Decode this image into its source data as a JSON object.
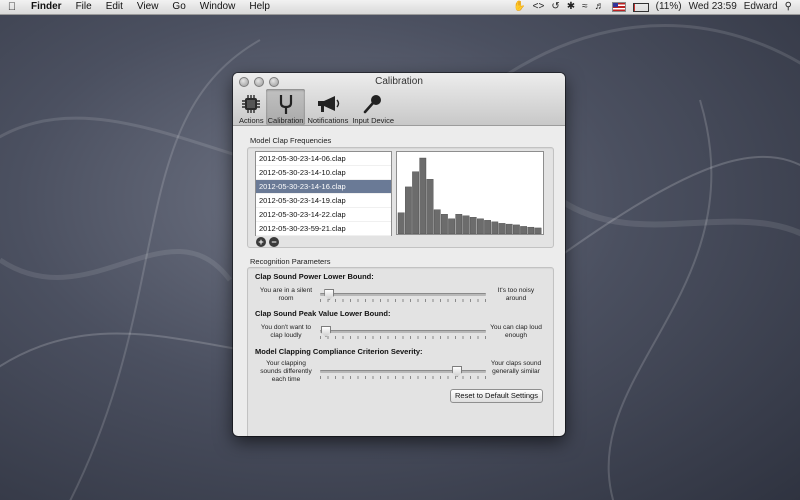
{
  "menubar": {
    "app_name": "Finder",
    "items": [
      "File",
      "Edit",
      "View",
      "Go",
      "Window",
      "Help"
    ],
    "battery_text": "(11%)",
    "battery_level": 0.11,
    "clock": "Wed 23:59",
    "user": "Edward",
    "tray_icons": [
      "clapper-icon",
      "code-icon",
      "time-machine-icon",
      "bluetooth-icon",
      "wifi-icon",
      "volume-icon",
      "flag-icon",
      "battery-icon",
      "search-icon"
    ]
  },
  "window": {
    "title": "Calibration",
    "toolbar": [
      {
        "label": "Actions",
        "icon": "chip-icon"
      },
      {
        "label": "Calibration",
        "icon": "tuning-fork-icon"
      },
      {
        "label": "Notifications",
        "icon": "megaphone-icon"
      },
      {
        "label": "Input Device",
        "icon": "microphone-icon"
      }
    ],
    "selected_tab": "Calibration"
  },
  "frequencies": {
    "label": "Model Clap Frequencies",
    "files": [
      "2012-05-30-23-14-06.clap",
      "2012-05-30-23-14-10.clap",
      "2012-05-30-23-14-16.clap",
      "2012-05-30-23-14-19.clap",
      "2012-05-30-23-14-22.clap",
      "2012-05-30-23-59-21.clap"
    ],
    "selected_index": 2,
    "add_label": "+",
    "remove_label": "−",
    "histogram": [
      0.28,
      0.62,
      0.82,
      1.0,
      0.72,
      0.32,
      0.26,
      0.2,
      0.26,
      0.24,
      0.22,
      0.2,
      0.18,
      0.16,
      0.14,
      0.13,
      0.12,
      0.1,
      0.09,
      0.08
    ]
  },
  "recognition": {
    "label": "Recognition Parameters",
    "params": [
      {
        "title": "Clap Sound Power Lower Bound:",
        "left_text": "You are in a silent room",
        "right_text": "It's too noisy around",
        "value": 0.05
      },
      {
        "title": "Clap Sound Peak Value Lower Bound:",
        "left_text": "You don't want to clap loudly",
        "right_text": "You can clap loud enough",
        "value": 0.03
      },
      {
        "title": "Model Clapping Compliance Criterion Severity:",
        "left_text": "Your clapping sounds differently each time",
        "right_text": "Your claps sound generally similar",
        "value": 0.82
      }
    ],
    "reset_label": "Reset to Default Settings"
  }
}
